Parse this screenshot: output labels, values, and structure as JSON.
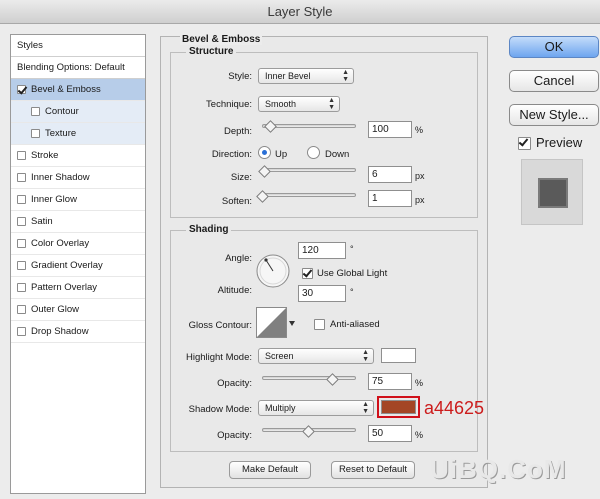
{
  "window": {
    "title": "Layer Style"
  },
  "styles_list": {
    "header": "Styles",
    "blending_options": "Blending Options: Default",
    "items": [
      {
        "label": "Bevel & Emboss",
        "checked": true,
        "selected": true
      },
      {
        "label": "Contour",
        "checked": false,
        "sub": true
      },
      {
        "label": "Texture",
        "checked": false,
        "sub": true
      },
      {
        "label": "Stroke",
        "checked": false
      },
      {
        "label": "Inner Shadow",
        "checked": false
      },
      {
        "label": "Inner Glow",
        "checked": false
      },
      {
        "label": "Satin",
        "checked": false
      },
      {
        "label": "Color Overlay",
        "checked": false
      },
      {
        "label": "Gradient Overlay",
        "checked": false
      },
      {
        "label": "Pattern Overlay",
        "checked": false
      },
      {
        "label": "Outer Glow",
        "checked": false
      },
      {
        "label": "Drop Shadow",
        "checked": false
      }
    ]
  },
  "panel": {
    "title": "Bevel & Emboss",
    "structure": {
      "title": "Structure",
      "style_label": "Style:",
      "style_value": "Inner Bevel",
      "technique_label": "Technique:",
      "technique_value": "Smooth",
      "depth_label": "Depth:",
      "depth_value": "100",
      "depth_unit": "%",
      "depth_slider": 0.1,
      "direction_label": "Direction:",
      "direction_up": "Up",
      "direction_down": "Down",
      "size_label": "Size:",
      "size_value": "6",
      "size_unit": "px",
      "size_slider": 0.03,
      "soften_label": "Soften:",
      "soften_value": "1",
      "soften_unit": "px",
      "soften_slider": 0.01
    },
    "shading": {
      "title": "Shading",
      "angle_label": "Angle:",
      "angle_value": "120",
      "angle_unit": "°",
      "use_global_light": "Use Global Light",
      "altitude_label": "Altitude:",
      "altitude_value": "30",
      "altitude_unit": "°",
      "gloss_label": "Gloss Contour:",
      "anti_aliased": "Anti-aliased",
      "highlight_mode_label": "Highlight Mode:",
      "highlight_mode_value": "Screen",
      "highlight_color": "#ffffff",
      "highlight_opacity_label": "Opacity:",
      "highlight_opacity_value": "75",
      "highlight_opacity_unit": "%",
      "highlight_opacity_slider": 0.75,
      "shadow_mode_label": "Shadow Mode:",
      "shadow_mode_value": "Multiply",
      "shadow_color": "#a44625",
      "shadow_opacity_label": "Opacity:",
      "shadow_opacity_value": "50",
      "shadow_opacity_unit": "%",
      "shadow_opacity_slider": 0.5
    },
    "make_default": "Make Default",
    "reset_to_default": "Reset to Default"
  },
  "side": {
    "ok": "OK",
    "cancel": "Cancel",
    "new_style": "New Style...",
    "preview": "Preview"
  },
  "annotation": "a44625",
  "watermark": "UiBQ.CoM"
}
